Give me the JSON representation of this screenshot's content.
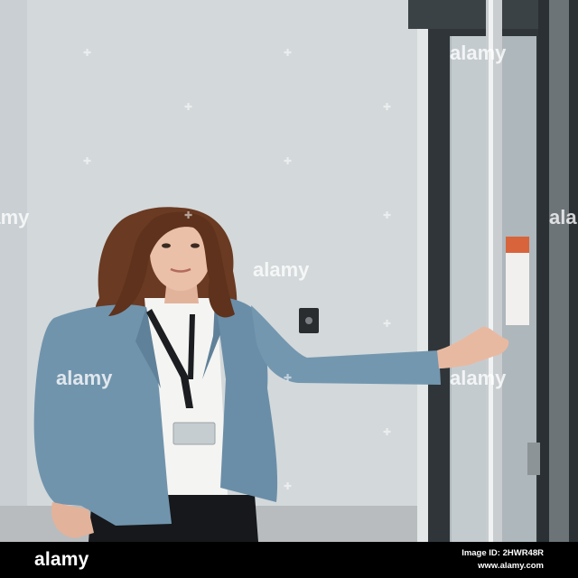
{
  "watermark": {
    "text": "alamy"
  },
  "footer": {
    "logo": "alamy",
    "image_id": "Image ID: 2HWR48R",
    "site": "www.alamy.com"
  },
  "colors": {
    "wall": "#d3d8da",
    "door_frame": "#3a4044",
    "jacket": "#7194ad",
    "hair": "#6a3a22",
    "footer_bg": "#000000"
  }
}
